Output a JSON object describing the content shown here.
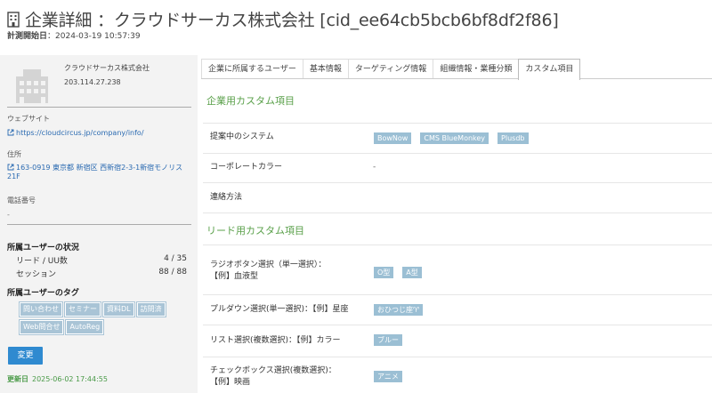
{
  "header": {
    "title": "企業詳細 ：クラウドサーカス株式会社 [cid_ee64cb5bcb6bf8df2f86]",
    "measure_label": "計測開始日",
    "measure_value": "：2024-03-19 10:57:39"
  },
  "sidebar": {
    "company_name": "クラウドサーカス株式会社",
    "ip": "203.114.27.238",
    "website_label": "ウェブサイト",
    "website_url": "https://cloudcircus.jp/company/info/",
    "address_label": "住所",
    "address": "163-0919 東京都 新宿区 西新宿2-3-1新宿モノリス21F",
    "phone_label": "電話番号",
    "phone_value": "-",
    "users_status_title": "所属ユーザーの状況",
    "stats": [
      {
        "label": "リード / UU数",
        "value": "4 / 35"
      },
      {
        "label": "セッション",
        "value": "88 / 88"
      }
    ],
    "tags_title": "所属ユーザーのタグ",
    "tags": [
      "問い合わせ",
      "セミナー",
      "資料DL",
      "訪問済",
      "Web問合せ",
      "AutoReg"
    ],
    "change_button": "変更",
    "updated_label": "更新日",
    "updated_value": "2025-06-02 17:44:55"
  },
  "tabs": [
    {
      "label": "企業に所属するユーザー",
      "active": false
    },
    {
      "label": "基本情報",
      "active": false
    },
    {
      "label": "ターゲティング情報",
      "active": false
    },
    {
      "label": "組織情報・業種分類",
      "active": false
    },
    {
      "label": "カスタム項目",
      "active": true
    }
  ],
  "company_section": {
    "title": "企業用カスタム項目",
    "rows": [
      {
        "label": "提案中のシステム",
        "chips": [
          "BowNow",
          "CMS BlueMonkey",
          "Plusdb"
        ]
      },
      {
        "label": "コーポレートカラー",
        "text": "-"
      },
      {
        "label": "連絡方法",
        "text": ""
      }
    ]
  },
  "lead_section": {
    "title": "リード用カスタム項目",
    "rows": [
      {
        "label": "ラジオボタン選択（単一選択）：\n【例】血液型",
        "chips": [
          "O型",
          "A型"
        ]
      },
      {
        "label": "プルダウン選択(単一選択)：【例】星座",
        "chips": [
          "おひつじ座♈"
        ]
      },
      {
        "label": "リスト選択(複数選択)：【例】カラー",
        "chips": [
          "ブルー"
        ]
      },
      {
        "label": "チェックボックス選択(複数選択)：\n【例】映画",
        "chips": [
          "アニメ"
        ]
      }
    ]
  },
  "colors": {
    "accent_green": "#5aa04a",
    "chip_blue": "#9bbfd4",
    "button_blue": "#2f8ad0",
    "link_blue": "#2a6ab1"
  }
}
